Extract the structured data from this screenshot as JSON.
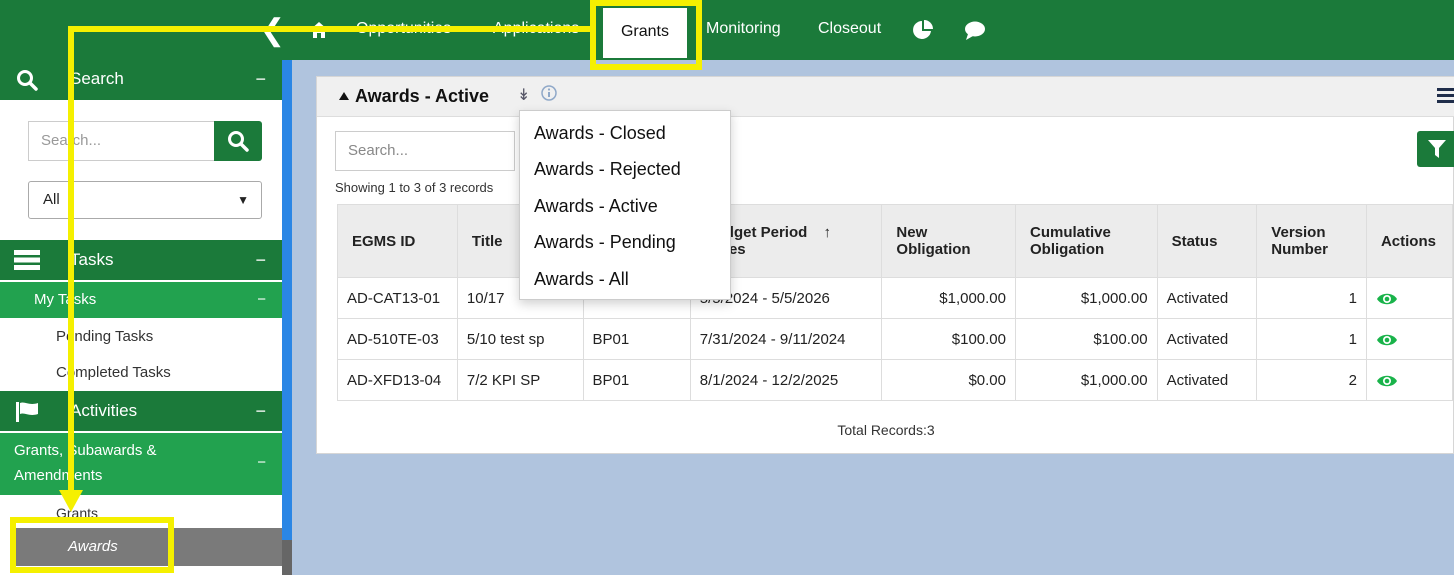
{
  "nav": {
    "items": [
      "Opportunities",
      "Applications",
      "Grants",
      "Monitoring",
      "Closeout"
    ],
    "active": "Grants"
  },
  "sidebar": {
    "search_section": "Search",
    "search_placeholder": "Search...",
    "search_scope": "All",
    "tasks_section": "Tasks",
    "my_tasks": "My Tasks",
    "pending_tasks": "Pending Tasks",
    "completed_tasks": "Completed Tasks",
    "activities_section": "Activities",
    "grants_sub_line1": "Grants, Subawards &",
    "grants_sub_line2": "Amendments",
    "grants_link": "Grants",
    "awards_link": "Awards",
    "collapse_symbol": "−"
  },
  "panel": {
    "title": "Awards - Active",
    "search_placeholder": "Search...",
    "showing": "Showing 1 to 3 of 3 records",
    "total": "Total Records:3"
  },
  "views_dropdown": [
    "Awards - Closed",
    "Awards - Rejected",
    "Awards - Active",
    "Awards - Pending",
    "Awards - All"
  ],
  "table": {
    "headers": {
      "egms_id": "EGMS ID",
      "title": "Title",
      "budget_period": "Budget Period",
      "budget_dates": "Dates",
      "sort_arrow": "↑",
      "new_obl_1": "New",
      "new_obl_2": "Obligation",
      "cum_obl_1": "Cumulative",
      "cum_obl_2": "Obligation",
      "status": "Status",
      "version_1": "Version",
      "version_2": "Number",
      "actions": "Actions"
    },
    "rows": [
      {
        "egms_id": "AD-CAT13-01",
        "title": "10/17",
        "budget_period": "",
        "dates": "5/5/2024 - 5/5/2026",
        "new_obligation": "$1,000.00",
        "cumulative_obligation": "$1,000.00",
        "status": "Activated",
        "version": "1"
      },
      {
        "egms_id": "AD-510TE-03",
        "title": "5/10 test sp",
        "budget_period": "BP01",
        "dates": "7/31/2024 - 9/11/2024",
        "new_obligation": "$100.00",
        "cumulative_obligation": "$100.00",
        "status": "Activated",
        "version": "1"
      },
      {
        "egms_id": "AD-XFD13-04",
        "title": "7/2 KPI SP",
        "budget_period": "BP01",
        "dates": "8/1/2024 - 12/2/2025",
        "new_obligation": "$0.00",
        "cumulative_obligation": "$1,000.00",
        "status": "Activated",
        "version": "2"
      }
    ]
  },
  "colors": {
    "brand_green": "#1b7a3a",
    "sub_green": "#22a24f",
    "action_eye": "#19b34a",
    "highlight": "#f5f000",
    "background": "#b0c4de"
  },
  "icons": [
    "chevron-left-icon",
    "home-icon",
    "pie-chart-icon",
    "chat-icon",
    "search-icon",
    "tasks-icon",
    "flag-icon",
    "filter-icon",
    "menu-icon",
    "eye-icon",
    "info-icon",
    "double-chevron-down-icon",
    "caret-up-icon"
  ]
}
